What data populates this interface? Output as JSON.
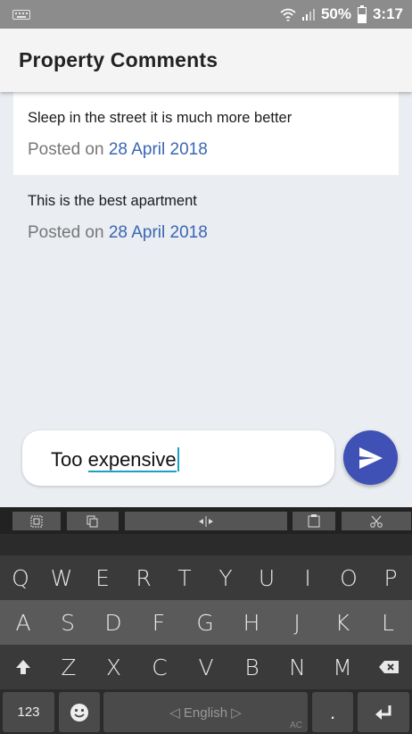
{
  "status": {
    "battery": "50%",
    "time": "3:17"
  },
  "header": {
    "title": "Property Comments"
  },
  "comments": [
    {
      "text": "Sleep in the street it is much more better",
      "posted_label": "Posted on",
      "date": "28 April 2018"
    },
    {
      "text": "This is the best apartment",
      "posted_label": "Posted on",
      "date": "28 April 2018"
    }
  ],
  "composer": {
    "text_before": "Too ",
    "text_underlined": "expensive"
  },
  "keyboard": {
    "row1": [
      "Q",
      "W",
      "E",
      "R",
      "T",
      "Y",
      "U",
      "I",
      "O",
      "P"
    ],
    "row2": [
      "A",
      "S",
      "D",
      "F",
      "G",
      "H",
      "J",
      "K",
      "L"
    ],
    "row3": [
      "Z",
      "X",
      "C",
      "V",
      "B",
      "N",
      "M"
    ],
    "numbers_label": "123",
    "space_label": "◁ English ▷",
    "period_label": ".",
    "space_badge": "AC"
  },
  "colors": {
    "accent": "#3f51b5",
    "date_link": "#3a66b3",
    "cursor": "#1aa2c6"
  }
}
